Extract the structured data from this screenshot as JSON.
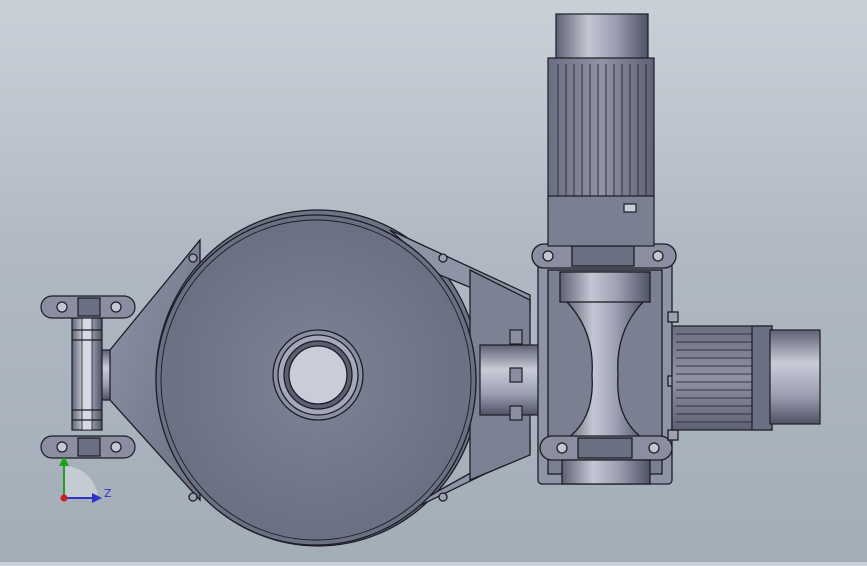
{
  "viewport": {
    "background_top": "#c9d0d8",
    "background_bottom": "#a3adb8"
  },
  "triad": {
    "z_label": "Z",
    "y_color": "#1fa01f",
    "z_color": "#2b33c8",
    "origin_color": "#c82020"
  },
  "model": {
    "body_color": "#7a7f92",
    "edge_color": "#1c1d24",
    "highlight_color": "#c9cbd6"
  }
}
